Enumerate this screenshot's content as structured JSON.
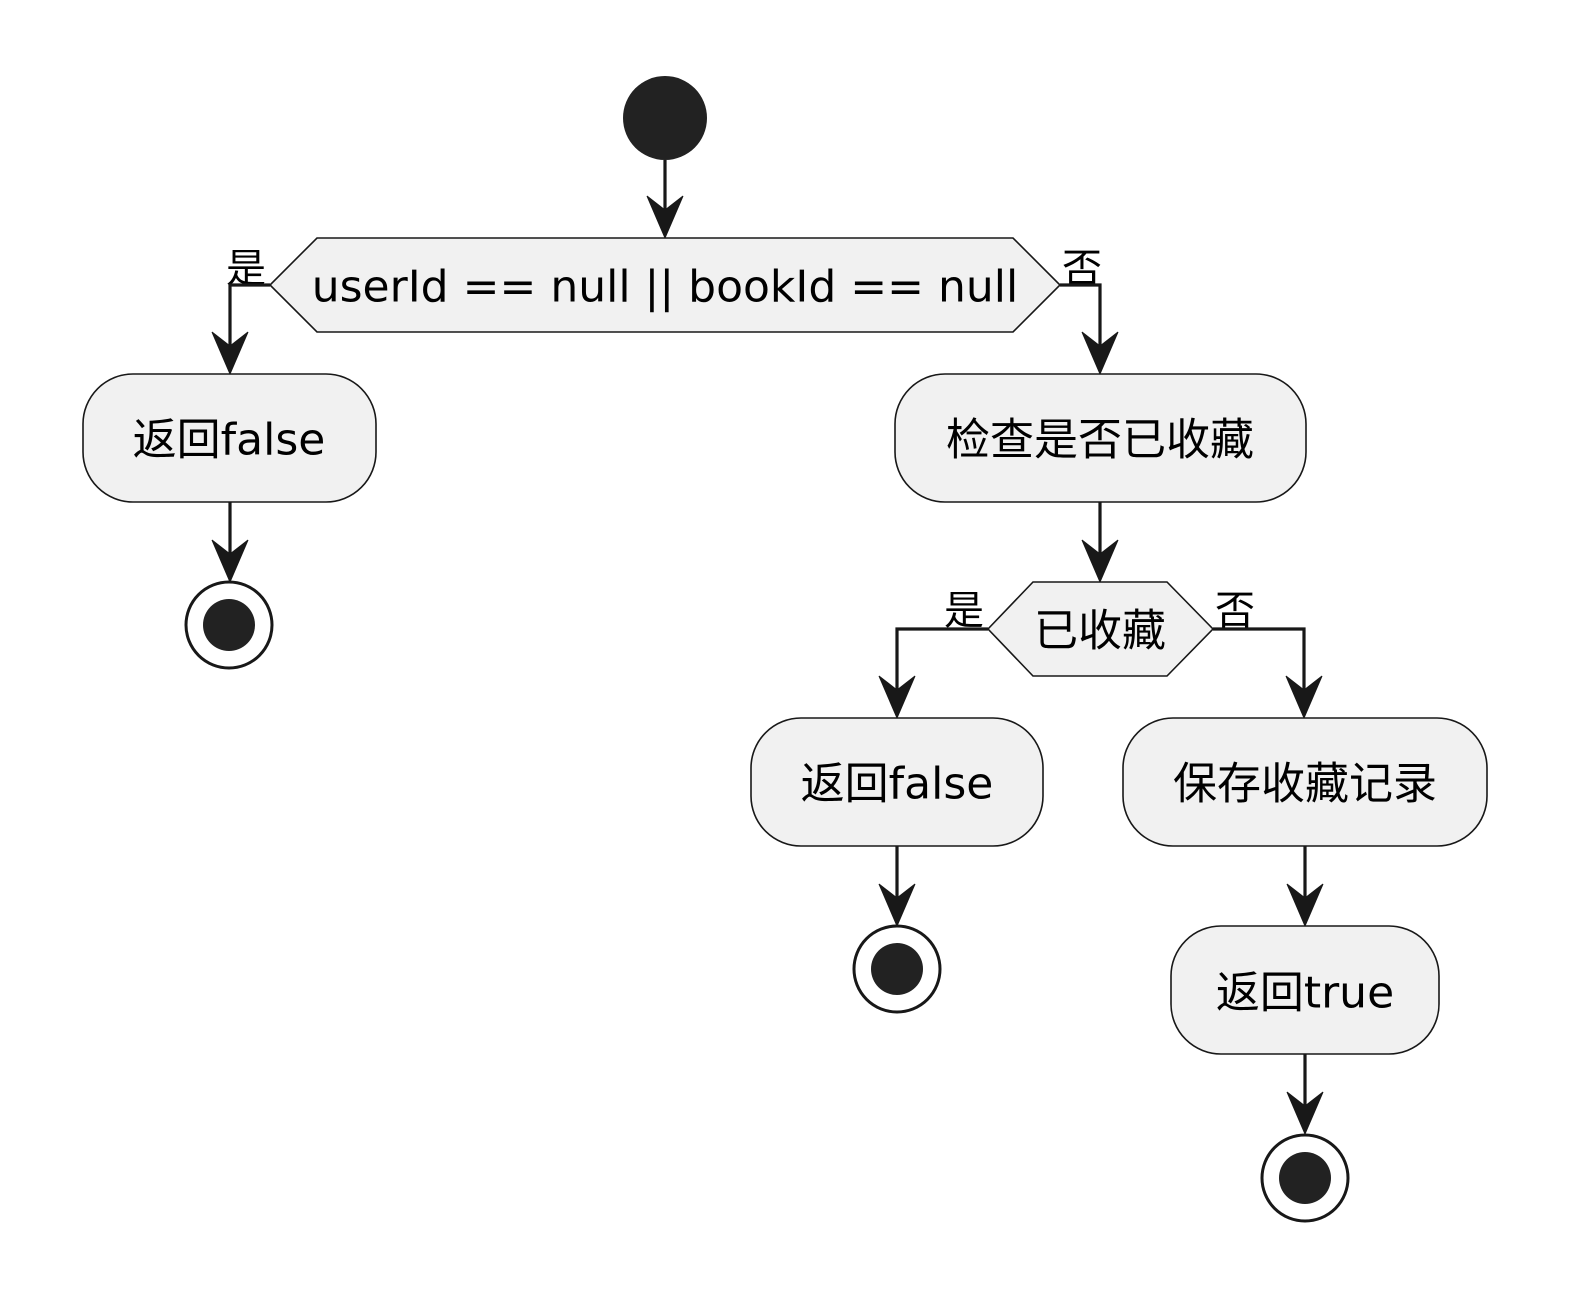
{
  "diagram": {
    "decision_main": {
      "label": "userId == null || bookId == null",
      "yes": "是",
      "no": "否"
    },
    "return_false_1": {
      "label": "返回false"
    },
    "check_favorited": {
      "label": "检查是否已收藏"
    },
    "decision_favorited": {
      "label": "已收藏",
      "yes": "是",
      "no": "否"
    },
    "return_false_2": {
      "label": "返回false"
    },
    "save_record": {
      "label": "保存收藏记录"
    },
    "return_true": {
      "label": "返回true"
    }
  },
  "colors": {
    "node_fill": "#f1f1f1",
    "stroke": "#181818",
    "dot": "#222222"
  }
}
